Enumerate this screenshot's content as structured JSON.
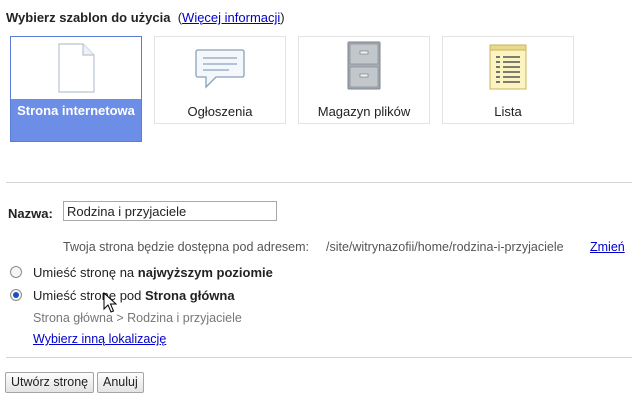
{
  "header": {
    "title": "Wybierz szablon do użycia",
    "more_info_link": "Więcej informacji",
    "paren_open": "(",
    "paren_close": ")"
  },
  "templates": [
    {
      "label": "Strona internetowa",
      "icon": "web-page-icon",
      "selected": true
    },
    {
      "label": "Ogłoszenia",
      "icon": "announcement-speech-bubble-icon",
      "selected": false
    },
    {
      "label": "Magazyn plików",
      "icon": "file-cabinet-icon",
      "selected": false
    },
    {
      "label": "Lista",
      "icon": "list-notepad-icon",
      "selected": false
    }
  ],
  "form": {
    "name_label": "Nazwa:",
    "name_value": "Rodzina i przyjaciele",
    "address_note": "Twoja strona będzie dostępna pod adresem:",
    "address_path": "/site/witrynazofii/home/rodzina-i-przyjaciele",
    "change_link": "Zmień"
  },
  "placement": {
    "option_top_prefix": "Umieść stronę na",
    "option_top_bold": "najwyższym poziomie",
    "option_under_prefix": "Umieść stronę pod",
    "option_under_bold": "Strona główna",
    "selected_option": "under",
    "location_path": "Strona główna > Rodzina i przyjaciele",
    "other_location_link": "Wybierz inną lokalizację"
  },
  "buttons": {
    "create": "Utwórz stronę",
    "cancel": "Anuluj"
  },
  "colors": {
    "selected_tile": "#6d8ee6",
    "link": "#0000cc",
    "radio_checked": "#1a4fc4"
  }
}
